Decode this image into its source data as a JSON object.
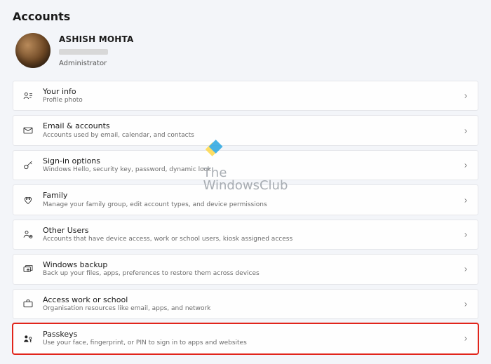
{
  "header": {
    "title": "Accounts"
  },
  "profile": {
    "name": "ASHISH MOHTA",
    "role": "Administrator"
  },
  "items": [
    {
      "icon": "person-card-icon",
      "title": "Your info",
      "desc": "Profile photo"
    },
    {
      "icon": "mail-icon",
      "title": "Email & accounts",
      "desc": "Accounts used by email, calendar, and contacts"
    },
    {
      "icon": "key-icon",
      "title": "Sign-in options",
      "desc": "Windows Hello, security key, password, dynamic lock"
    },
    {
      "icon": "family-icon",
      "title": "Family",
      "desc": "Manage your family group, edit account types, and device permissions"
    },
    {
      "icon": "other-users-icon",
      "title": "Other Users",
      "desc": "Accounts that have device access, work or school users, kiosk assigned access"
    },
    {
      "icon": "backup-icon",
      "title": "Windows backup",
      "desc": "Back up your files, apps, preferences to restore them across devices"
    },
    {
      "icon": "briefcase-icon",
      "title": "Access work or school",
      "desc": "Organisation resources like email, apps, and network"
    },
    {
      "icon": "passkey-icon",
      "title": "Passkeys",
      "desc": "Use your face, fingerprint, or PIN to sign in to apps and websites",
      "highlighted": true
    }
  ],
  "watermark": {
    "line1": "The",
    "line2": "WindowsClub"
  },
  "colors": {
    "highlight_outline": "#e1251b",
    "page_bg": "#f3f5f9",
    "card_border": "#e5e6ea"
  }
}
